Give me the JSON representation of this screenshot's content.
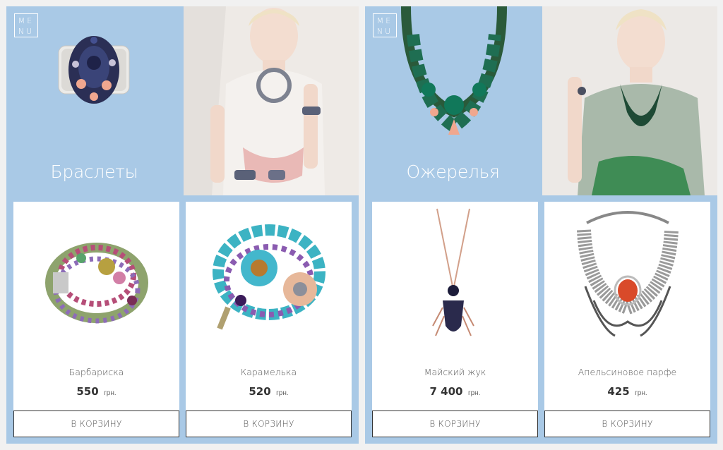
{
  "menu": {
    "line1": "ME",
    "line2": "NU"
  },
  "left": {
    "category": "Браслеты",
    "products": [
      {
        "name": "Барбариска",
        "price": "550",
        "currency": "грн.",
        "cart": "В КОРЗИНУ"
      },
      {
        "name": "Карамелька",
        "price": "520",
        "currency": "грн.",
        "cart": "В КОРЗИНУ"
      }
    ]
  },
  "right": {
    "category": "Ожерелья",
    "products": [
      {
        "name": "Майский жук",
        "price": "7 400",
        "currency": "грн.",
        "cart": "В КОРЗИНУ"
      },
      {
        "name": "Апельсиновое парфе",
        "price": "425",
        "currency": "грн.",
        "cart": "В КОРЗИНУ"
      }
    ]
  },
  "colors": {
    "panel": "#a9c9e6",
    "background": "#f1f1f1",
    "card": "#ffffff",
    "button_border": "#333333"
  },
  "icons": [
    "menu-icon",
    "cuff-bracelet-image",
    "model-photo",
    "necklace-image"
  ]
}
